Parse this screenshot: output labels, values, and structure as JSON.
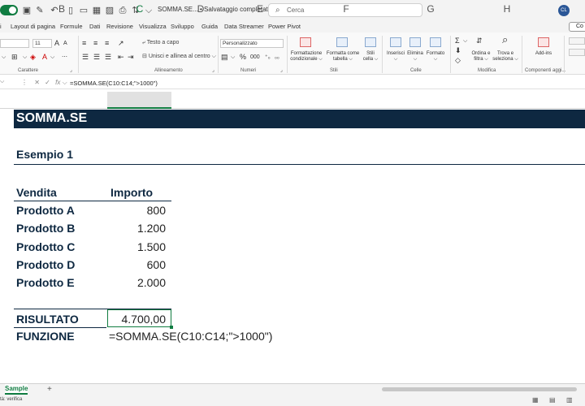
{
  "titlebar": {
    "title": "SOMMA.SE... • Salvataggio completato ⌵",
    "search_placeholder": "Cerca",
    "avatar_initials": "CL"
  },
  "menu": {
    "tabs": [
      "Layout di pagina",
      "Formule",
      "Dati",
      "Revisione",
      "Visualizza",
      "Sviluppo",
      "Guida",
      "Data Streamer",
      "Power Pivot"
    ],
    "share_label": "Co"
  },
  "ribbon": {
    "font_size": "11",
    "wrap_text": "Testo a capo",
    "merge_center": "Unisci e allinea al centro",
    "number_format": "Personalizzato",
    "groups": {
      "font": "Carattere",
      "alignment": "Allineamento",
      "number": "Numeri",
      "styles": "Stili",
      "cells": "Celle",
      "editing": "Modifica",
      "addins": "Componenti aggi..."
    },
    "buttons": {
      "conditional_format": "Formattazione\ncondizionale ⌵",
      "format_table": "Formatta come\ntabella ⌵",
      "cell_styles": "Stili\ncella ⌵",
      "insert": "Inserisci",
      "delete": "Elimina",
      "format": "Formato",
      "sort_filter": "Ordina e\nfiltra ⌵",
      "find_select": "Trova e\nseleziona ⌵",
      "addins": "Add-ins"
    }
  },
  "formula_bar": {
    "formula": "=SOMMA.SE(C10:C14;\">1000\")"
  },
  "columns": [
    "B",
    "C",
    "D",
    "E",
    "F",
    "G",
    "H"
  ],
  "sheet": {
    "band_title": "SOMMA.SE",
    "section_title": "Esempio 1",
    "header_vendita": "Vendita",
    "header_importo": "Importo",
    "rows": [
      {
        "product": "Prodotto A",
        "amount": "800"
      },
      {
        "product": "Prodotto B",
        "amount": "1.200"
      },
      {
        "product": "Prodotto C",
        "amount": "1.500"
      },
      {
        "product": "Prodotto D",
        "amount": "600"
      },
      {
        "product": "Prodotto E",
        "amount": "2.000"
      }
    ],
    "result_label": "RISULTATO",
    "result_value": "4.700,00",
    "function_label": "FUNZIONE",
    "function_text": "=SOMMA.SE(C10:C14;\">1000\")"
  },
  "bottom": {
    "sheet_tab": "Sample",
    "add_sheet": "+",
    "status": "tà: verifica"
  },
  "colors": {
    "excel_green": "#107c41",
    "navy": "#0e2841"
  }
}
